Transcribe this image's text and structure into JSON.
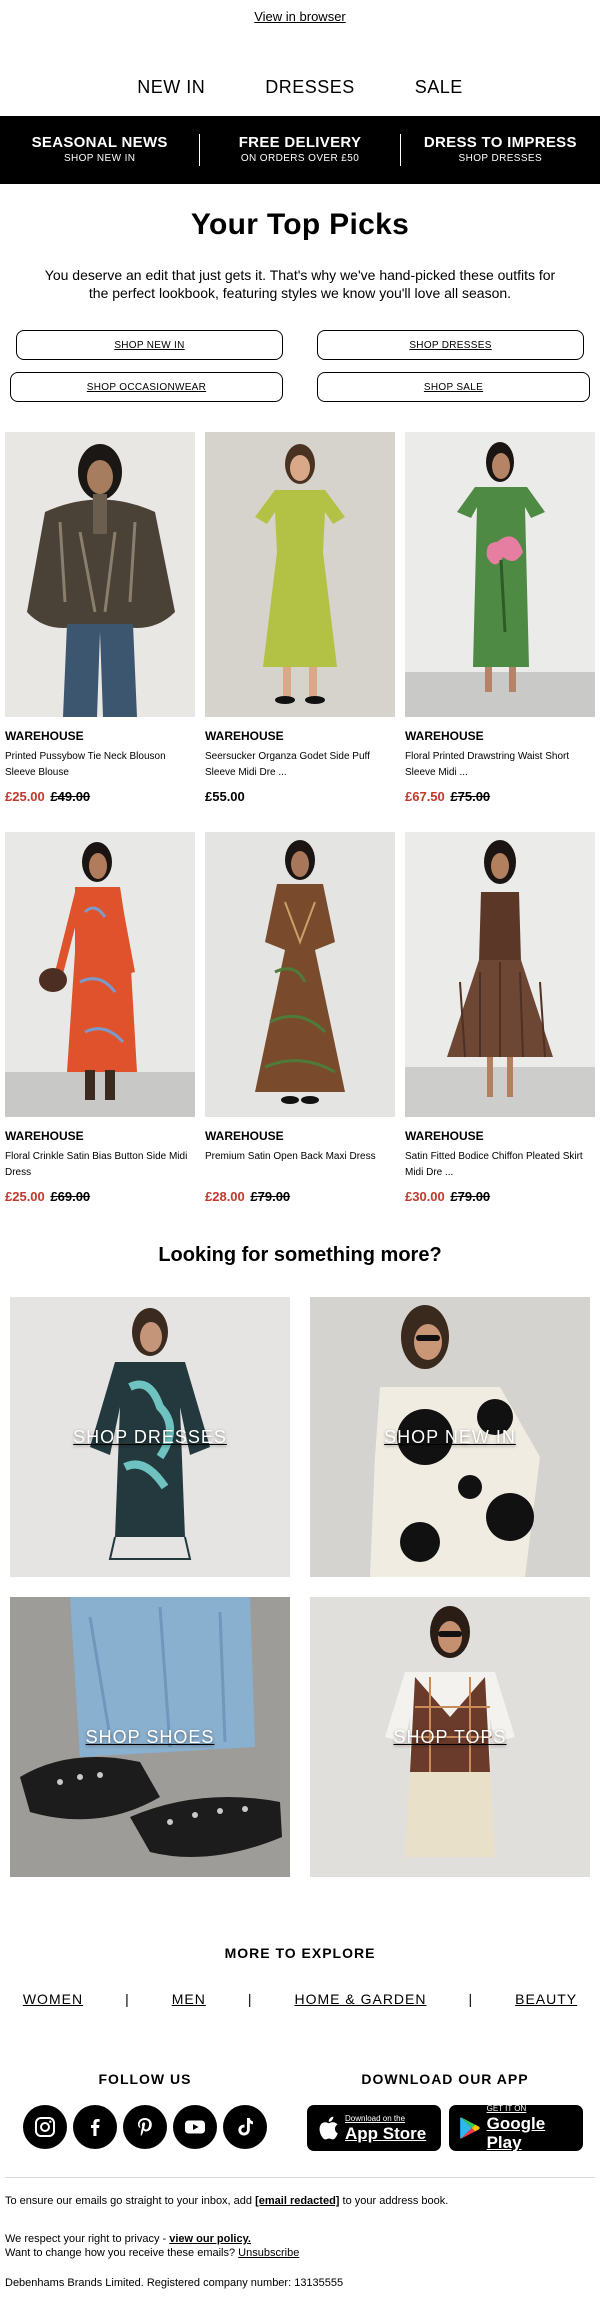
{
  "header": {
    "view_in_browser": "View in browser",
    "nav": [
      "NEW IN",
      "DRESSES",
      "SALE"
    ]
  },
  "promo": [
    {
      "title": "SEASONAL NEWS",
      "sub": "SHOP NEW IN"
    },
    {
      "title": "FREE DELIVERY",
      "sub": "ON ORDERS OVER £50"
    },
    {
      "title": "DRESS TO IMPRESS",
      "sub": "SHOP DRESSES"
    }
  ],
  "hero": {
    "title": "Your Top Picks",
    "text": "You deserve an edit that just gets it. That's why we've hand-picked these outfits for the perfect lookbook, featuring styles we know you'll love all season."
  },
  "buttons": [
    "SHOP NEW IN",
    "SHOP DRESSES",
    "SHOP OCCASIONWEAR",
    "SHOP SALE"
  ],
  "products": [
    {
      "brand": "WAREHOUSE",
      "name": "Printed Pussybow Tie Neck Blouson Sleeve Blouse",
      "price": "£25.00",
      "was": "£49.00"
    },
    {
      "brand": "WAREHOUSE",
      "name": "Seersucker Organza Godet Side Puff Sleeve Midi Dre ...",
      "price": "£55.00",
      "was": ""
    },
    {
      "brand": "WAREHOUSE",
      "name": "Floral Printed Drawstring Waist Short Sleeve Midi ...",
      "price": "£67.50",
      "was": "£75.00"
    },
    {
      "brand": "WAREHOUSE",
      "name": "Floral Crinkle Satin Bias Button Side Midi Dress",
      "price": "£25.00",
      "was": "£69.00"
    },
    {
      "brand": "WAREHOUSE",
      "name": "Premium Satin Open Back Maxi Dress",
      "price": "£28.00",
      "was": "£79.00"
    },
    {
      "brand": "WAREHOUSE",
      "name": "Satin Fitted Bodice Chiffon Pleated Skirt Midi Dre ...",
      "price": "£30.00",
      "was": "£79.00"
    }
  ],
  "more": {
    "title": "Looking for something more?",
    "tiles": [
      "SHOP DRESSES",
      "SHOP NEW IN",
      "SHOP SHOES",
      "SHOP TOPS"
    ]
  },
  "explore": {
    "title": "MORE TO EXPLORE",
    "links": [
      "WOMEN",
      "MEN",
      "HOME & GARDEN",
      "BEAUTY"
    ],
    "separator": "|"
  },
  "follow": {
    "title": "FOLLOW US",
    "icons": [
      "instagram-icon",
      "facebook-icon",
      "pinterest-icon",
      "youtube-icon",
      "tiktok-icon"
    ]
  },
  "app": {
    "title": "DOWNLOAD OUR APP",
    "appstore_small": "Download on the",
    "appstore_big": "App Store",
    "google_small": "GET IT ON",
    "google_big": "Google Play"
  },
  "footer": {
    "inbox_pre": "To ensure our emails go straight to your inbox, add",
    "inbox_email": "[email redacted]",
    "inbox_post": "to your address book.",
    "privacy_pre": "We respect your right to privacy -",
    "privacy_link": "view our policy.",
    "change_pre": "Want to change how you receive these emails?",
    "unsubscribe": "Unsubscribe",
    "company": "Debenhams Brands Limited. Registered company number: 13135555"
  },
  "colors": {
    "sale_red": "#c0392b",
    "promo_bg": "#000000",
    "tile_bg": "#e6e4e2"
  }
}
